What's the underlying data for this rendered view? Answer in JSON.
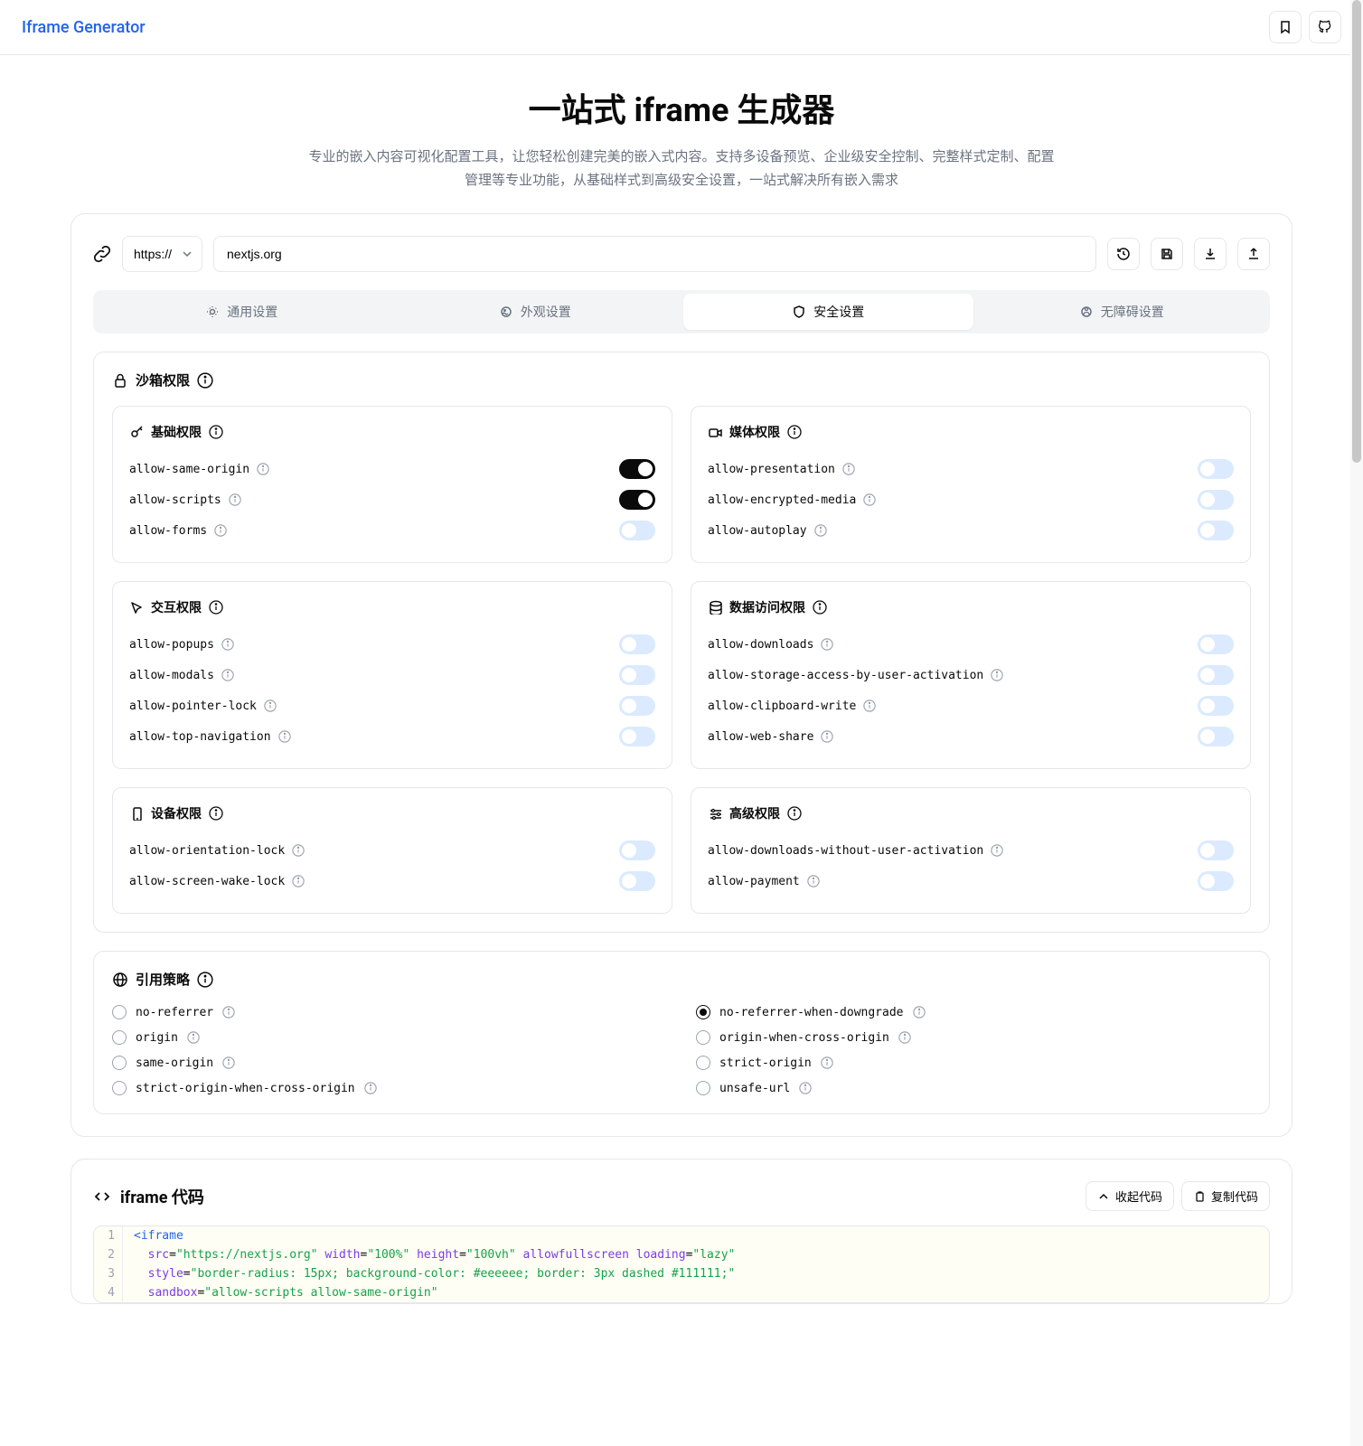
{
  "brand": "Iframe Generator",
  "hero": {
    "title": "一站式 iframe 生成器",
    "subtitle": "专业的嵌入内容可视化配置工具，让您轻松创建完美的嵌入式内容。支持多设备预览、企业级安全控制、完整样式定制、配置管理等专业功能，从基础样式到高级安全设置，一站式解决所有嵌入需求"
  },
  "url": {
    "protocol": "https://",
    "value": "nextjs.org"
  },
  "tabs": [
    {
      "label": "通用设置"
    },
    {
      "label": "外观设置"
    },
    {
      "label": "安全设置"
    },
    {
      "label": "无障碍设置"
    }
  ],
  "activeTab": 2,
  "sandbox": {
    "title": "沙箱权限",
    "groups": [
      {
        "title": "基础权限",
        "items": [
          {
            "name": "allow-same-origin",
            "on": true
          },
          {
            "name": "allow-scripts",
            "on": true
          },
          {
            "name": "allow-forms",
            "on": false
          }
        ]
      },
      {
        "title": "媒体权限",
        "items": [
          {
            "name": "allow-presentation",
            "on": false
          },
          {
            "name": "allow-encrypted-media",
            "on": false
          },
          {
            "name": "allow-autoplay",
            "on": false
          }
        ]
      },
      {
        "title": "交互权限",
        "items": [
          {
            "name": "allow-popups",
            "on": false
          },
          {
            "name": "allow-modals",
            "on": false
          },
          {
            "name": "allow-pointer-lock",
            "on": false
          },
          {
            "name": "allow-top-navigation",
            "on": false
          }
        ]
      },
      {
        "title": "数据访问权限",
        "items": [
          {
            "name": "allow-downloads",
            "on": false
          },
          {
            "name": "allow-storage-access-by-user-activation",
            "on": false
          },
          {
            "name": "allow-clipboard-write",
            "on": false
          },
          {
            "name": "allow-web-share",
            "on": false
          }
        ]
      },
      {
        "title": "设备权限",
        "items": [
          {
            "name": "allow-orientation-lock",
            "on": false
          },
          {
            "name": "allow-screen-wake-lock",
            "on": false
          }
        ]
      },
      {
        "title": "高级权限",
        "items": [
          {
            "name": "allow-downloads-without-user-activation",
            "on": false
          },
          {
            "name": "allow-payment",
            "on": false
          }
        ]
      }
    ]
  },
  "referrer": {
    "title": "引用策略",
    "selected": "no-referrer-when-downgrade",
    "options": [
      "no-referrer",
      "no-referrer-when-downgrade",
      "origin",
      "origin-when-cross-origin",
      "same-origin",
      "strict-origin",
      "strict-origin-when-cross-origin",
      "unsafe-url"
    ]
  },
  "code": {
    "title": "iframe 代码",
    "collapse": "收起代码",
    "copy": "复制代码",
    "lines": [
      [
        {
          "c": "t-tag",
          "t": "<iframe"
        }
      ],
      [
        {
          "c": "",
          "t": "  "
        },
        {
          "c": "t-attr",
          "t": "src"
        },
        {
          "c": "",
          "t": "="
        },
        {
          "c": "t-str",
          "t": "\"https://nextjs.org\""
        },
        {
          "c": "",
          "t": " "
        },
        {
          "c": "t-attr",
          "t": "width"
        },
        {
          "c": "",
          "t": "="
        },
        {
          "c": "t-str",
          "t": "\"100%\""
        },
        {
          "c": "",
          "t": " "
        },
        {
          "c": "t-attr",
          "t": "height"
        },
        {
          "c": "",
          "t": "="
        },
        {
          "c": "t-str",
          "t": "\"100vh\""
        },
        {
          "c": "",
          "t": " "
        },
        {
          "c": "t-attr",
          "t": "allowfullscreen"
        },
        {
          "c": "",
          "t": " "
        },
        {
          "c": "t-attr",
          "t": "loading"
        },
        {
          "c": "",
          "t": "="
        },
        {
          "c": "t-str",
          "t": "\"lazy\""
        }
      ],
      [
        {
          "c": "",
          "t": "  "
        },
        {
          "c": "t-attr",
          "t": "style"
        },
        {
          "c": "",
          "t": "="
        },
        {
          "c": "t-str",
          "t": "\"border-radius: 15px; background-color: #eeeeee; border: 3px dashed #111111;\""
        }
      ],
      [
        {
          "c": "",
          "t": "  "
        },
        {
          "c": "t-attr",
          "t": "sandbox"
        },
        {
          "c": "",
          "t": "="
        },
        {
          "c": "t-str",
          "t": "\"allow-scripts allow-same-origin\""
        }
      ]
    ]
  },
  "groupIcons": [
    "key",
    "video",
    "cursor",
    "database",
    "phone",
    "sliders"
  ]
}
